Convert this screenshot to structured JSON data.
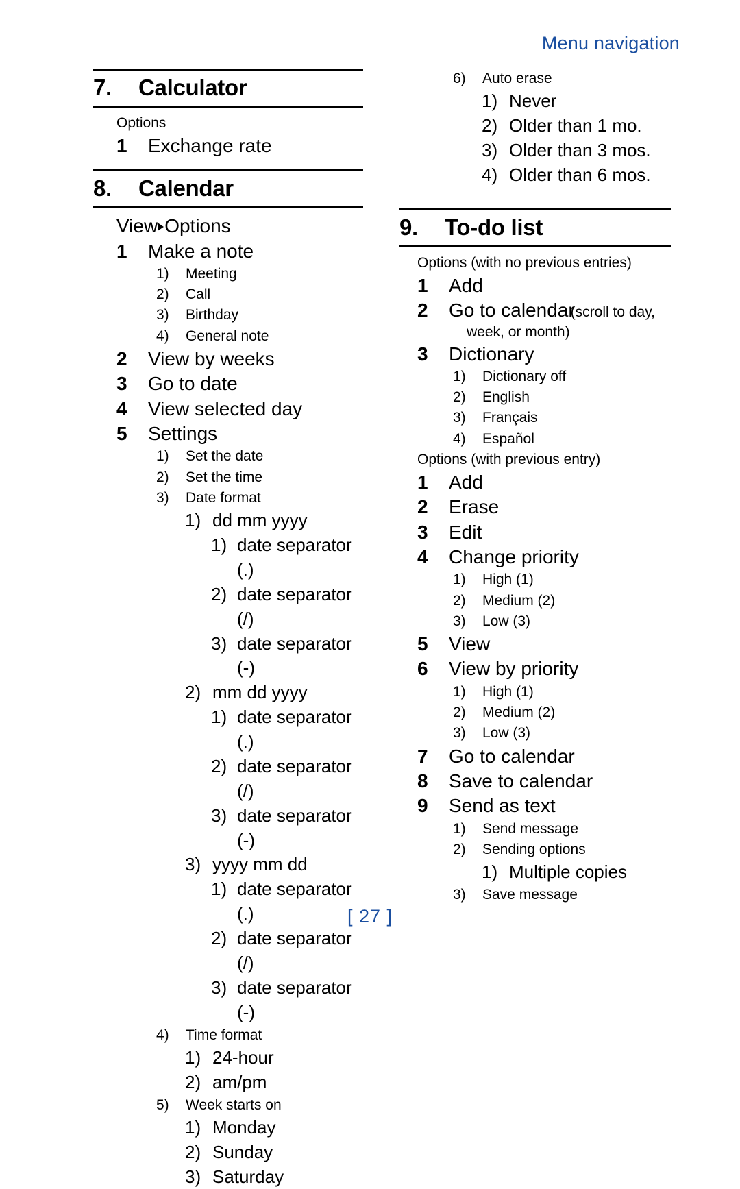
{
  "running_head": "Menu navigation",
  "footer": "[ 27 ]",
  "colors": {
    "accent_blue": "#1B4FA0",
    "text": "#000000",
    "rule": "#000000"
  },
  "left_column": {
    "calculator": {
      "number": "7.",
      "title": "Calculator",
      "caption": "Options",
      "items": [
        {
          "marker": "1",
          "label": "Exchange rate"
        }
      ]
    },
    "calendar": {
      "number": "8.",
      "title": "Calendar",
      "view_options_prefix": "View",
      "view_options_suffix": "Options",
      "items": [
        {
          "marker": "1",
          "label": "Make a note"
        },
        {
          "marker": "1)",
          "label": "Meeting"
        },
        {
          "marker": "2)",
          "label": "Call"
        },
        {
          "marker": "3)",
          "label": "Birthday"
        },
        {
          "marker": "4)",
          "label": "General note"
        },
        {
          "marker": "2",
          "label": "View by weeks"
        },
        {
          "marker": "3",
          "label": "Go to date"
        },
        {
          "marker": "4",
          "label": "View selected day"
        },
        {
          "marker": "5",
          "label": "Settings"
        },
        {
          "marker": "1)",
          "label": "Set the date"
        },
        {
          "marker": "2)",
          "label": "Set the time"
        },
        {
          "marker": "3)",
          "label": "Date format"
        },
        {
          "marker": "1)",
          "label": "dd mm yyyy"
        },
        {
          "marker": "1)",
          "label": "date separator (.)"
        },
        {
          "marker": "2)",
          "label": "date separator (/)"
        },
        {
          "marker": "3)",
          "label": "date separator (-)"
        },
        {
          "marker": "2)",
          "label": "mm dd yyyy"
        },
        {
          "marker": "1)",
          "label": "date separator (.)"
        },
        {
          "marker": "2)",
          "label": "date separator (/)"
        },
        {
          "marker": "3)",
          "label": "date separator (-)"
        },
        {
          "marker": "3)",
          "label": "yyyy mm dd"
        },
        {
          "marker": "1)",
          "label": "date separator (.)"
        },
        {
          "marker": "2)",
          "label": "date separator (/)"
        },
        {
          "marker": "3)",
          "label": "date separator (-)"
        },
        {
          "marker": "4)",
          "label": "Time format"
        },
        {
          "marker": "1)",
          "label": "24-hour"
        },
        {
          "marker": "2)",
          "label": "am/pm"
        },
        {
          "marker": "5)",
          "label": "Week starts on"
        },
        {
          "marker": "1)",
          "label": "Monday"
        },
        {
          "marker": "2)",
          "label": "Sunday"
        },
        {
          "marker": "3)",
          "label": "Saturday"
        }
      ]
    }
  },
  "right_column": {
    "auto_erase": {
      "items": [
        {
          "marker": "6)",
          "label": "Auto erase"
        },
        {
          "marker": "1)",
          "label": "Never"
        },
        {
          "marker": "2)",
          "label": "Older than 1 mo."
        },
        {
          "marker": "3)",
          "label": "Older than 3 mos."
        },
        {
          "marker": "4)",
          "label": "Older than 6 mos."
        }
      ]
    },
    "todo": {
      "number": "9.",
      "title": "To-do list",
      "caption_no_entries": "Options (with no previous entries)",
      "caption_with_entry": "Options (with previous entry)",
      "go_to_calendar_label": "Go to calendar",
      "go_to_calendar_note": "(scroll to day,",
      "go_to_calendar_note_cont": "week, or month)",
      "items_no_entries": [
        {
          "marker": "1",
          "label": "Add"
        },
        {
          "marker": "3",
          "label": "Dictionary"
        },
        {
          "marker": "1)",
          "label": "Dictionary off"
        },
        {
          "marker": "2)",
          "label": "English"
        },
        {
          "marker": "3)",
          "label": "Français"
        },
        {
          "marker": "4)",
          "label": "Español"
        }
      ],
      "items_with_entry": [
        {
          "marker": "1",
          "label": "Add"
        },
        {
          "marker": "2",
          "label": "Erase"
        },
        {
          "marker": "3",
          "label": "Edit"
        },
        {
          "marker": "4",
          "label": "Change priority"
        },
        {
          "marker": "1)",
          "label": "High (1)"
        },
        {
          "marker": "2)",
          "label": "Medium (2)"
        },
        {
          "marker": "3)",
          "label": "Low (3)"
        },
        {
          "marker": "5",
          "label": "View"
        },
        {
          "marker": "6",
          "label": "View by priority"
        },
        {
          "marker": "1)",
          "label": "High (1)"
        },
        {
          "marker": "2)",
          "label": "Medium (2)"
        },
        {
          "marker": "3)",
          "label": "Low (3)"
        },
        {
          "marker": "7",
          "label": "Go to calendar"
        },
        {
          "marker": "8",
          "label": "Save to calendar"
        },
        {
          "marker": "9",
          "label": "Send as text"
        },
        {
          "marker": "1)",
          "label": "Send message"
        },
        {
          "marker": "2)",
          "label": "Sending options"
        },
        {
          "marker": "1)",
          "label": "Multiple copies"
        },
        {
          "marker": "3)",
          "label": "Save message"
        }
      ]
    }
  }
}
